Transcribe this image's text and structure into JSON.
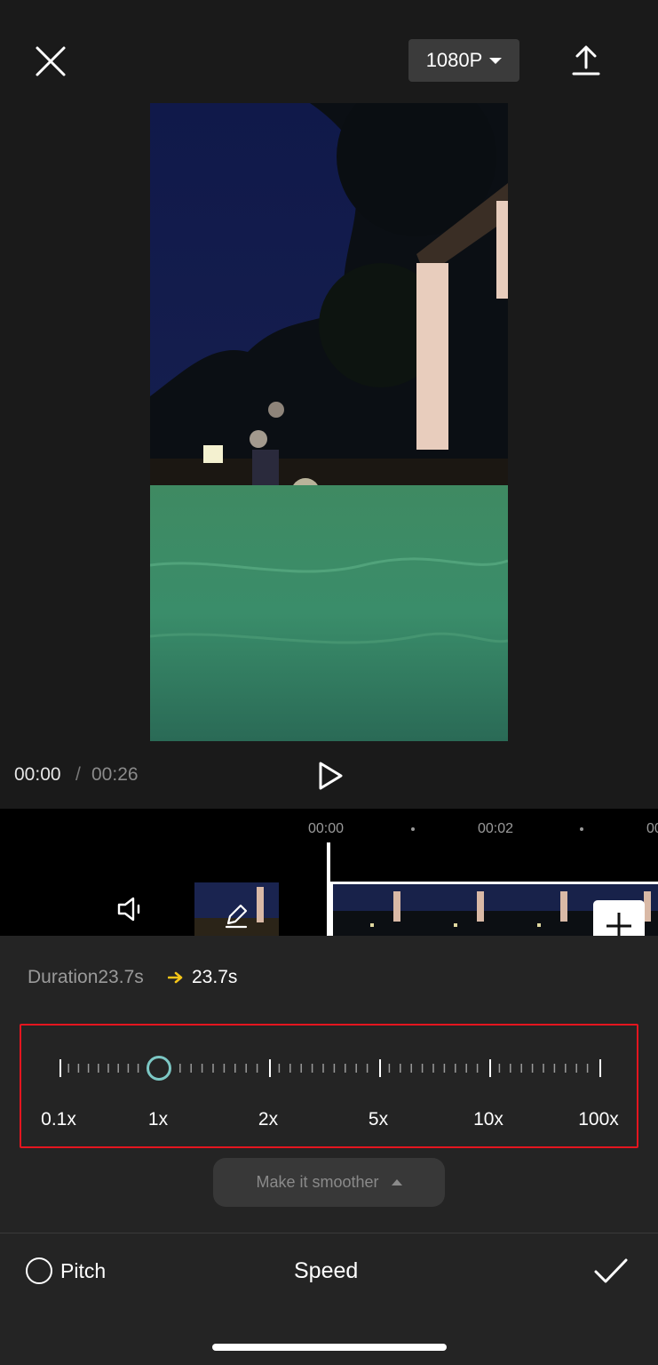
{
  "header": {
    "close_icon": "close-icon",
    "resolution": "1080P",
    "export_icon": "export-upload-icon"
  },
  "player": {
    "current_time": "00:00",
    "separator": "/",
    "total_time": "00:26",
    "play_icon": "play-icon"
  },
  "timeline": {
    "ticks": [
      "00:00",
      "00:02",
      "00"
    ],
    "mute_icon": "speaker-mute-icon",
    "cover_edit_icon": "pencil-icon",
    "add_icon": "plus-icon"
  },
  "speed_panel": {
    "duration_label": "Duration23.7s",
    "duration_new": "23.7s",
    "speed_levels": [
      "0.1x",
      "1x",
      "2x",
      "5x",
      "10x",
      "100x"
    ],
    "current_speed_index": 1,
    "smoother_label": "Make it smoother",
    "pitch_label": "Pitch",
    "title": "Speed",
    "confirm_icon": "check-icon"
  },
  "colors": {
    "highlight_box": "#e4151f",
    "knob": "#7cc7c4",
    "arrow": "#f5c518"
  }
}
